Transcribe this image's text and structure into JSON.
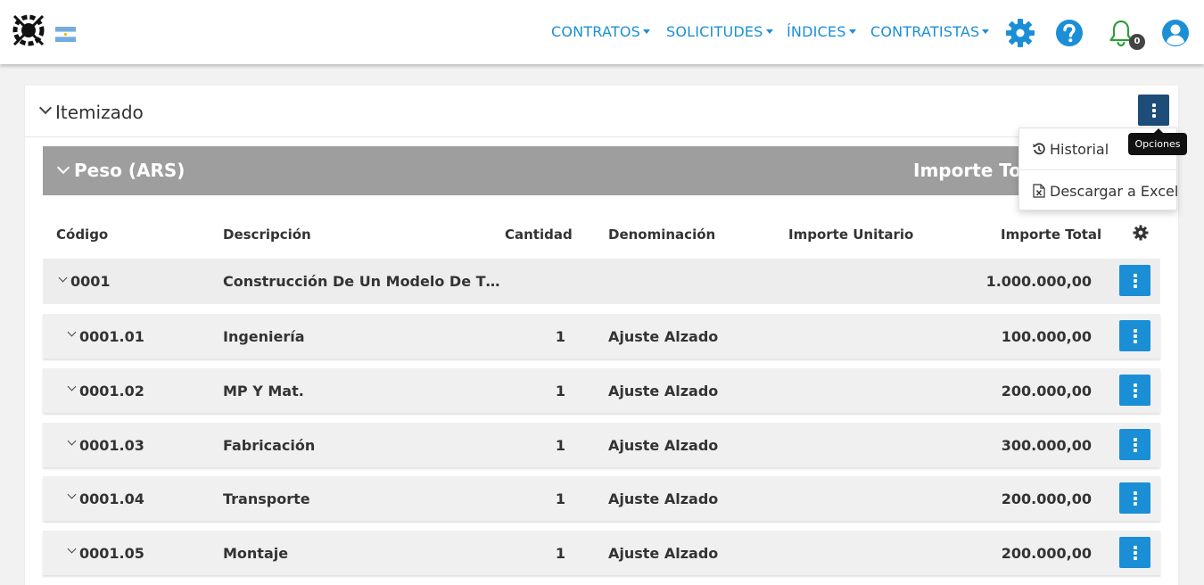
{
  "nav": {
    "items": [
      {
        "label": "CONTRATOS"
      },
      {
        "label": "SOLICITUDES"
      },
      {
        "label": "ÍNDICES"
      },
      {
        "label": "CONTRATISTAS"
      }
    ],
    "notification_count": "0"
  },
  "card": {
    "title": "Itemizado",
    "options_tooltip": "Opciones",
    "menu": [
      {
        "label": "Historial",
        "icon": "history-icon"
      },
      {
        "label": "Descargar a Excel",
        "icon": "excel-file-icon"
      }
    ]
  },
  "section": {
    "title": "Peso (ARS)",
    "total_label": "Importe Total"
  },
  "table": {
    "headers": {
      "codigo": "Código",
      "descripcion": "Descripción",
      "cantidad": "Cantidad",
      "denominacion": "Denominación",
      "importe_unitario": "Importe Unitario",
      "importe_total": "Importe Total"
    },
    "rows": [
      {
        "codigo": "0001",
        "descripcion": "Construcción De Un Modelo De T…",
        "cantidad": "",
        "denominacion": "",
        "importe_total": "1.000.000,00"
      },
      {
        "codigo": "0001.01",
        "descripcion": "Ingeniería",
        "cantidad": "1",
        "denominacion": "Ajuste Alzado",
        "importe_total": "100.000,00"
      },
      {
        "codigo": "0001.02",
        "descripcion": "MP Y Mat.",
        "cantidad": "1",
        "denominacion": "Ajuste Alzado",
        "importe_total": "200.000,00"
      },
      {
        "codigo": "0001.03",
        "descripcion": "Fabricación",
        "cantidad": "1",
        "denominacion": "Ajuste Alzado",
        "importe_total": "300.000,00"
      },
      {
        "codigo": "0001.04",
        "descripcion": "Transporte",
        "cantidad": "1",
        "denominacion": "Ajuste Alzado",
        "importe_total": "200.000,00"
      },
      {
        "codigo": "0001.05",
        "descripcion": "Montaje",
        "cantidad": "1",
        "denominacion": "Ajuste Alzado",
        "importe_total": "200.000,00"
      }
    ]
  },
  "colors": {
    "nav_blue": "#1a8fd6",
    "options_button": "#1f4d7a",
    "section_gray": "#9e9e9e",
    "bell_green": "#2e9e3a"
  }
}
